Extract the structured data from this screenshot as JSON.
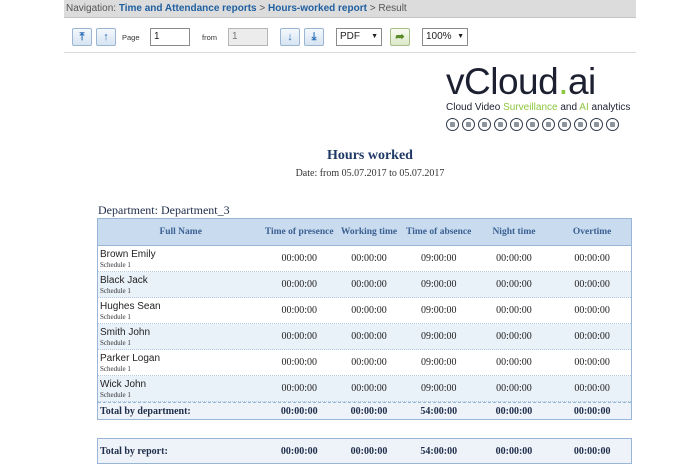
{
  "navigation": {
    "prefix": "Navigation:",
    "crumbs": [
      "Time and Attendance reports",
      "Hours-worked report",
      "Result"
    ],
    "separator": ">"
  },
  "toolbar": {
    "page_label": "Page",
    "page_value": "1",
    "from_label": "from",
    "from_value": "1",
    "format_value": "PDF",
    "zoom_value": "100%",
    "icons": [
      "first-page-icon",
      "previous-page-icon",
      "next-page-icon",
      "last-page-icon",
      "export-icon"
    ]
  },
  "logo": {
    "word": "vCloud",
    "dot": ".",
    "suffix": "ai",
    "tag_prefix": "Cloud Video",
    "tag_green1": "Surveillance",
    "tag_and": "and",
    "tag_green2": "AI",
    "tag_end": "analytics"
  },
  "report": {
    "title": "Hours worked",
    "date_line": "Date: from 05.07.2017 to 05.07.2017",
    "department": "Department: Department_3"
  },
  "table": {
    "headers": [
      "Full Name",
      "Time of presence",
      "Working time",
      "Time of absence",
      "Night time",
      "Overtime"
    ],
    "rows": [
      {
        "name": "Brown Emily",
        "schedule": "Schedule 1",
        "presence": "00:00:00",
        "working": "00:00:00",
        "absence": "09:00:00",
        "night": "00:00:00",
        "overtime": "00:00:00"
      },
      {
        "name": "Black Jack",
        "schedule": "Schedule 1",
        "presence": "00:00:00",
        "working": "00:00:00",
        "absence": "09:00:00",
        "night": "00:00:00",
        "overtime": "00:00:00"
      },
      {
        "name": "Hughes Sean",
        "schedule": "Schedule 1",
        "presence": "00:00:00",
        "working": "00:00:00",
        "absence": "09:00:00",
        "night": "00:00:00",
        "overtime": "00:00:00"
      },
      {
        "name": "Smith John",
        "schedule": "Schedule 1",
        "presence": "00:00:00",
        "working": "00:00:00",
        "absence": "09:00:00",
        "night": "00:00:00",
        "overtime": "00:00:00"
      },
      {
        "name": "Parker Logan",
        "schedule": "Schedule 1",
        "presence": "00:00:00",
        "working": "00:00:00",
        "absence": "09:00:00",
        "night": "00:00:00",
        "overtime": "00:00:00"
      },
      {
        "name": "Wick John",
        "schedule": "Schedule 1",
        "presence": "00:00:00",
        "working": "00:00:00",
        "absence": "09:00:00",
        "night": "00:00:00",
        "overtime": "00:00:00"
      }
    ],
    "dept_total": {
      "label": "Total by department:",
      "presence": "00:00:00",
      "working": "00:00:00",
      "absence": "54:00:00",
      "night": "00:00:00",
      "overtime": "00:00:00"
    },
    "report_total": {
      "label": "Total by report:",
      "presence": "00:00:00",
      "working": "00:00:00",
      "absence": "54:00:00",
      "night": "00:00:00",
      "overtime": "00:00:00"
    }
  },
  "colors": {
    "header_bg": "#c9dcef",
    "header_text": "#3a5f92",
    "link": "#1f5fa0",
    "logo_green": "#8dc63f"
  }
}
